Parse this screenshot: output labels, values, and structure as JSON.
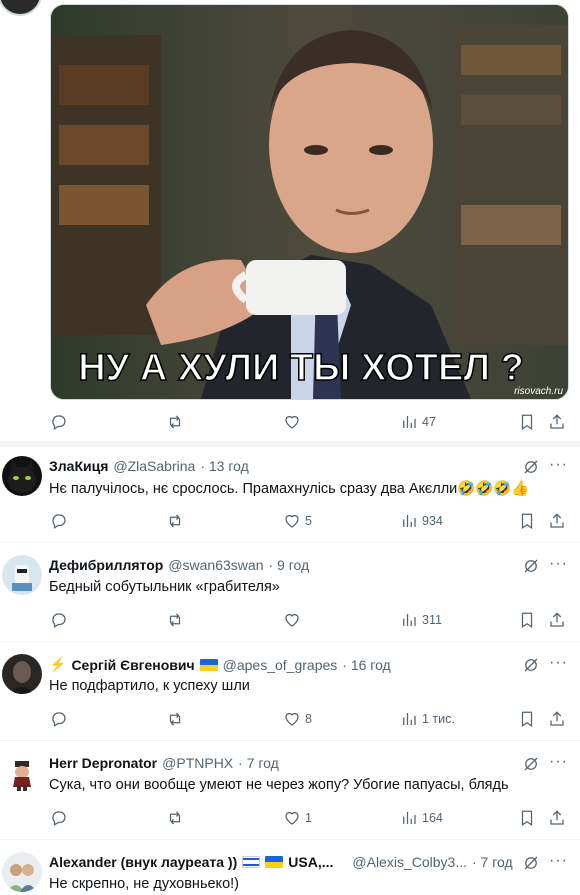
{
  "image_post": {
    "caption": "НУ А ХУЛИ ТЫ ХОТЕЛ ?",
    "watermark": "risovach.ru",
    "stats": {
      "views": "47"
    }
  },
  "tweets": [
    {
      "name": "ЗлаКиця",
      "handle": "@ZlaSabrina",
      "time": "· 13 год",
      "text": "Нє палучілось, нє срослось. Прамахнулісь сразу два Акєлли🤣🤣🤣👍",
      "replies": "",
      "retweets": "",
      "likes": "5",
      "views": "934"
    },
    {
      "name": "Дефибриллятор",
      "handle": "@swan63swan",
      "time": "· 9 год",
      "text": "Бедный собутыльник «грабителя»",
      "replies": "",
      "retweets": "",
      "likes": "",
      "views": "311"
    },
    {
      "name_prefix": "⚡",
      "name": "Сергій Євгенович",
      "handle": "@apes_of_grapes",
      "time": "· 16 год",
      "text": "Не подфартило, к успеху шли",
      "replies": "",
      "retweets": "",
      "likes": "8",
      "views": "1 тис."
    },
    {
      "name": "Herr Depronator",
      "handle": "@PTNPHX",
      "time": "· 7 год",
      "text": "Сука, что они вообще умеют не через жопу? Убогие папуасы, блядь",
      "replies": "",
      "retweets": "",
      "likes": "1",
      "views": "164"
    },
    {
      "name": "Alexander (внук лауреата ))",
      "name_suffix": "USA,...",
      "handle": "@Alexis_Colby3...",
      "time": "· 7 год",
      "text": "Не скрепно, не духовньеко!)"
    }
  ],
  "colors": {
    "text": "#0f1419",
    "secondary": "#536471",
    "divider": "#eff3f4"
  },
  "icons": [
    "reply-icon",
    "retweet-icon",
    "like-icon",
    "views-icon",
    "bookmark-icon",
    "share-icon",
    "grok-icon",
    "more-icon"
  ]
}
